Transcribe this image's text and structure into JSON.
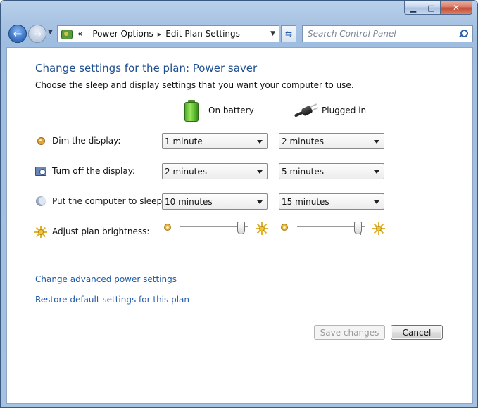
{
  "window": {
    "minimize_glyph": "▁",
    "maximize_glyph": "□",
    "close_glyph": "✕"
  },
  "nav": {
    "back_glyph": "←",
    "forward_glyph": "→"
  },
  "address": {
    "chevrons": "«",
    "breadcrumb": [
      "Power Options",
      "Edit Plan Settings"
    ],
    "separator": "▸"
  },
  "search": {
    "placeholder": "Search Control Panel"
  },
  "main": {
    "heading": "Change settings for the plan: Power saver",
    "subtitle": "Choose the sleep and display settings that you want your computer to use.",
    "columns": {
      "battery": "On battery",
      "plugged": "Plugged in"
    },
    "rows": {
      "dim": {
        "label": "Dim the display:",
        "battery_value": "1 minute",
        "plugged_value": "2 minutes"
      },
      "turn_off": {
        "label": "Turn off the display:",
        "battery_value": "2 minutes",
        "plugged_value": "5 minutes"
      },
      "sleep": {
        "label": "Put the computer to sleep:",
        "battery_value": "10 minutes",
        "plugged_value": "15 minutes"
      },
      "brightness": {
        "label": "Adjust plan brightness:",
        "battery_level": 0.95,
        "plugged_level": 0.95
      }
    },
    "links": {
      "advanced": "Change advanced power settings",
      "restore": "Restore default settings for this plan"
    }
  },
  "footer": {
    "save_label": "Save changes",
    "cancel_label": "Cancel"
  },
  "colors": {
    "heading": "#1e4f8f",
    "link": "#1e5aa8",
    "window_frame": "#a9c4e3"
  }
}
